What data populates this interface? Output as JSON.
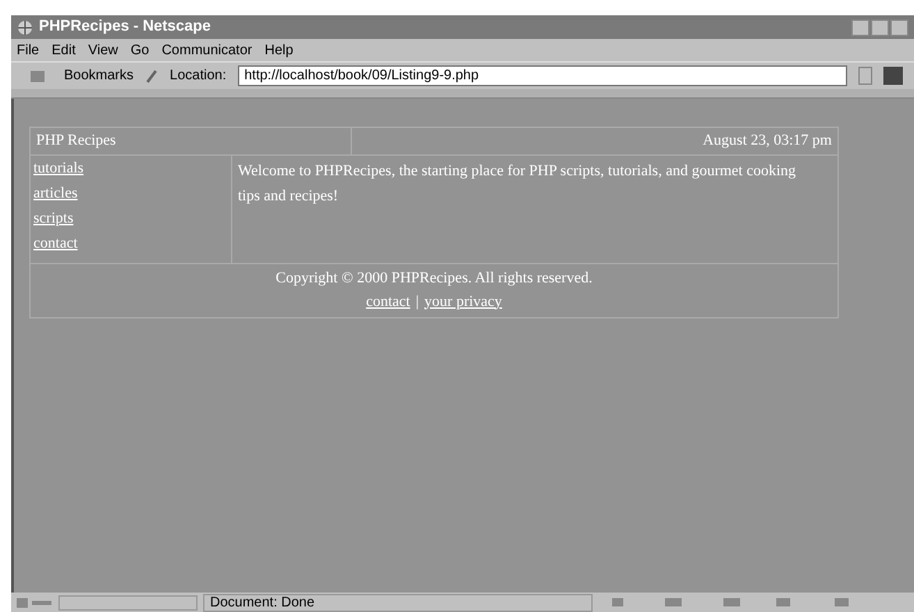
{
  "window": {
    "title": "PHPRecipes - Netscape"
  },
  "menu": [
    "File",
    "Edit",
    "View",
    "Go",
    "Communicator",
    "Help"
  ],
  "toolbar": {
    "bookmarks": "Bookmarks",
    "location_label": "Location:",
    "url": "http://localhost/book/09/Listing9-9.php"
  },
  "page": {
    "site_title": "PHP Recipes",
    "date": "August 23, 03:17 pm",
    "nav": [
      "tutorials",
      "articles",
      "scripts",
      "contact"
    ],
    "welcome": "Welcome to PHPRecipes, the starting place for PHP scripts, tutorials, and gourmet cooking tips and recipes!",
    "copyright": "Copyright © 2000 PHPRecipes. All rights reserved.",
    "footer_links": [
      "contact",
      "your privacy"
    ],
    "separator": "|"
  },
  "status_bar": {
    "text": "Document: Done"
  }
}
